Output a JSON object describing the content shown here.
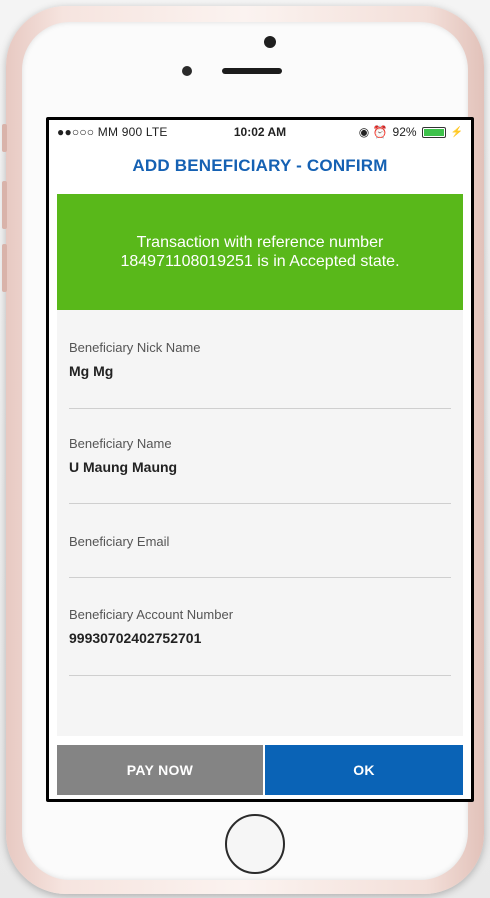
{
  "status_bar": {
    "carrier": "●●○○○ MM 900  LTE",
    "time": "10:02 AM",
    "icons": "◉ ⏰",
    "battery": "92%",
    "battery_level": 0.92,
    "charging_icon": "⚡"
  },
  "header": {
    "title": "ADD BENEFICIARY - CONFIRM"
  },
  "banner": {
    "message": "Transaction with reference  number 184971108019251 is in Accepted state."
  },
  "fields": [
    {
      "label": "Beneficiary Nick Name",
      "value": "Mg Mg"
    },
    {
      "label": "Beneficiary Name",
      "value": "U Maung Maung"
    },
    {
      "label": "Beneficiary Email",
      "value": ""
    },
    {
      "label": "Beneficiary Account Number",
      "value": "99930702402752701"
    }
  ],
  "buttons": {
    "pay_now": "PAY NOW",
    "ok": "OK"
  },
  "colors": {
    "title": "#1561b3",
    "banner": "#59b81a",
    "pay_now": "#848484",
    "ok": "#0a63b6"
  }
}
